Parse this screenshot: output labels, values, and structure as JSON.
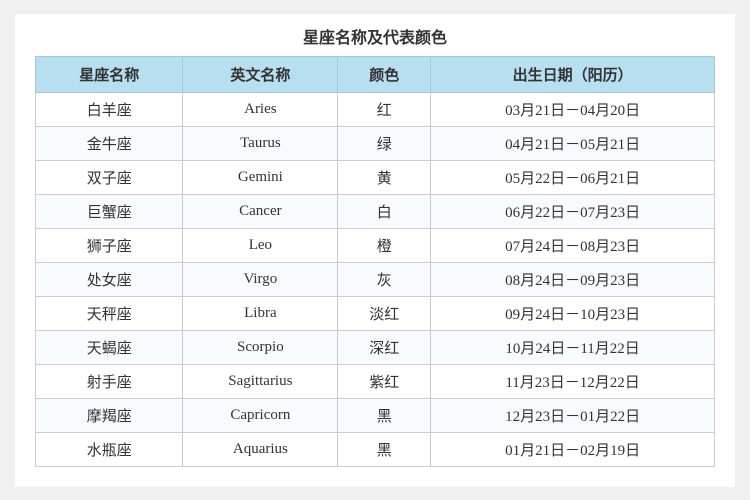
{
  "title": "星座名称及代表颜色",
  "headers": [
    "星座名称",
    "英文名称",
    "颜色",
    "出生日期（阳历）"
  ],
  "rows": [
    {
      "chinese": "白羊座",
      "english": "Aries",
      "color": "红",
      "dates": "03月21日－04月20日"
    },
    {
      "chinese": "金牛座",
      "english": "Taurus",
      "color": "绿",
      "dates": "04月21日－05月21日"
    },
    {
      "chinese": "双子座",
      "english": "Gemini",
      "color": "黄",
      "dates": "05月22日－06月21日"
    },
    {
      "chinese": "巨蟹座",
      "english": "Cancer",
      "color": "白",
      "dates": "06月22日－07月23日"
    },
    {
      "chinese": "狮子座",
      "english": "Leo",
      "color": "橙",
      "dates": "07月24日－08月23日"
    },
    {
      "chinese": "处女座",
      "english": "Virgo",
      "color": "灰",
      "dates": "08月24日－09月23日"
    },
    {
      "chinese": "天秤座",
      "english": "Libra",
      "color": "淡红",
      "dates": "09月24日－10月23日"
    },
    {
      "chinese": "天蝎座",
      "english": "Scorpio",
      "color": "深红",
      "dates": "10月24日－11月22日"
    },
    {
      "chinese": "射手座",
      "english": "Sagittarius",
      "color": "紫红",
      "dates": "11月23日－12月22日"
    },
    {
      "chinese": "摩羯座",
      "english": "Capricorn",
      "color": "黑",
      "dates": "12月23日－01月22日"
    },
    {
      "chinese": "水瓶座",
      "english": "Aquarius",
      "color": "黑",
      "dates": "01月21日－02月19日"
    }
  ]
}
